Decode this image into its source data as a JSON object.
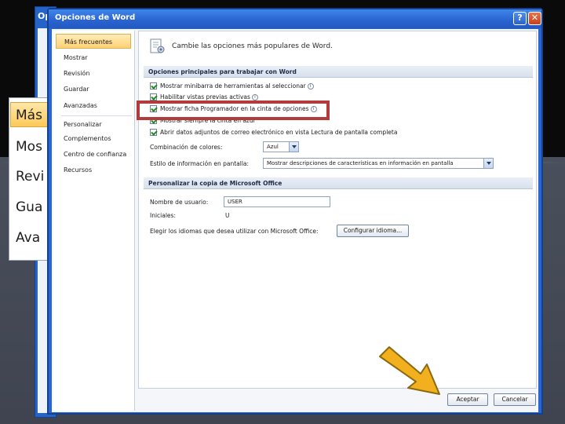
{
  "background_window": {
    "title_partial": "Op"
  },
  "zoom_callout": {
    "items": [
      "Más",
      "Mos",
      "Revi",
      "Gua",
      "Ava"
    ]
  },
  "dialog": {
    "title": "Opciones de Word",
    "help_button": "?",
    "close_button": "✕",
    "nav": [
      "Más frecuentes",
      "Mostrar",
      "Revisión",
      "Guardar",
      "Avanzadas",
      "Personalizar",
      "Complementos",
      "Centro de confianza",
      "Recursos"
    ],
    "header_text": "Cambie las opciones más populares de Word.",
    "section1": {
      "title": "Opciones principales para trabajar con Word",
      "options": [
        "Mostrar minibarra de herramientas al seleccionar",
        "Habilitar vistas previas activas",
        "Mostrar ficha Programador en la cinta de opciones",
        "Mostrar siempre la cinta en azul",
        "Abrir datos adjuntos de correo electrónico en vista Lectura de pantalla completa"
      ],
      "color_scheme_label": "Combinación de colores:",
      "color_scheme_value": "Azul",
      "screentip_label": "Estilo de información en pantalla:",
      "screentip_value": "Mostrar descripciones de características en información en pantalla"
    },
    "section2": {
      "title": "Personalizar la copia de Microsoft Office",
      "username_label": "Nombre de usuario:",
      "username_value": "USER",
      "initials_label": "Iniciales:",
      "initials_value": "U",
      "languages_label": "Elegir los idiomas que desea utilizar con Microsoft Office:",
      "languages_button": "Configurar idioma..."
    },
    "ok_button": "Aceptar",
    "cancel_button": "Cancelar"
  },
  "colors": {
    "titlebar": "#2a63cf",
    "nav_selected": "#fdd074",
    "highlight_box": "#b43b3b",
    "arrow_fill": "#f2b01e"
  }
}
